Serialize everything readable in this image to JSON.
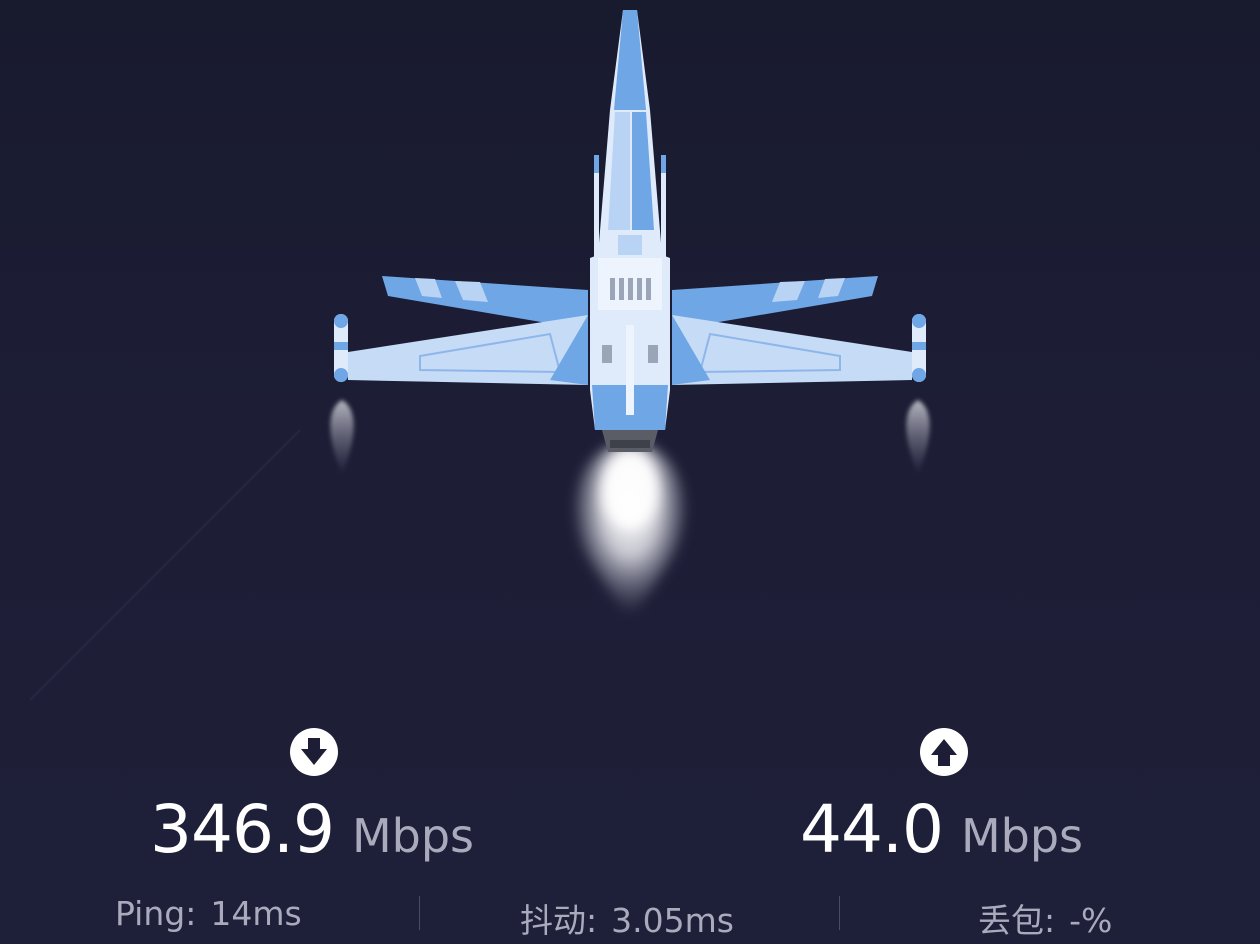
{
  "download": {
    "icon": "arrow-down-circle-icon",
    "value": "346.9",
    "unit": "Mbps"
  },
  "upload": {
    "icon": "arrow-up-circle-icon",
    "value": "44.0",
    "unit": "Mbps"
  },
  "stats": {
    "ping": {
      "label": "Ping:",
      "value": "14ms"
    },
    "jitter": {
      "label": "抖动:",
      "value": "3.05ms"
    },
    "packet_loss": {
      "label": "丢包:",
      "value": "-%"
    }
  },
  "colors": {
    "background": "#1d1e36",
    "jet_primary": "#6fa6e6",
    "jet_light": "#dfeafb",
    "value_text": "#ffffff",
    "unit_text": "#a9abbd"
  }
}
